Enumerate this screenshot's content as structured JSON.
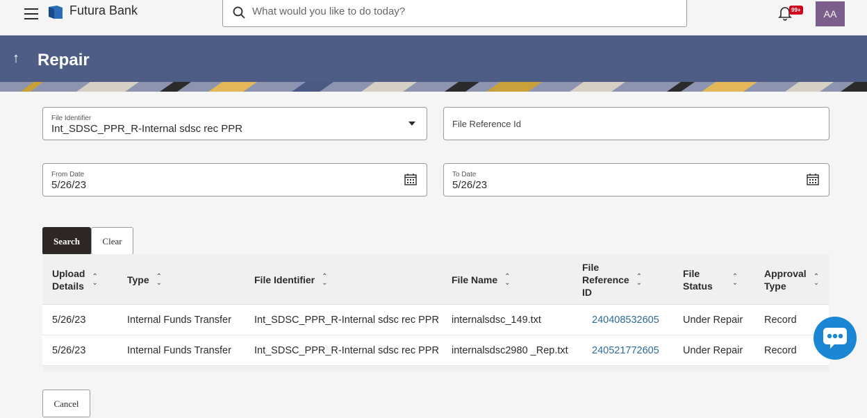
{
  "header": {
    "brand": "Futura Bank",
    "search_placeholder": "What would you like to do today?",
    "notification_count": "99+",
    "avatar_initials": "AA"
  },
  "banner": {
    "title": "Repair"
  },
  "form": {
    "file_identifier": {
      "label": "File Identifier",
      "value": "Int_SDSC_PPR_R-Internal sdsc rec PPR"
    },
    "file_reference": {
      "placeholder": "File Reference Id"
    },
    "from_date": {
      "label": "From Date",
      "value": "5/26/23"
    },
    "to_date": {
      "label": "To Date",
      "value": "5/26/23"
    },
    "search_label": "Search",
    "clear_label": "Clear"
  },
  "table": {
    "columns": [
      {
        "line1": "Upload",
        "line2": "Details",
        "line3": ""
      },
      {
        "line1": "Type",
        "line2": "",
        "line3": ""
      },
      {
        "line1": "File Identifier",
        "line2": "",
        "line3": ""
      },
      {
        "line1": "File Name",
        "line2": "",
        "line3": ""
      },
      {
        "line1": "File",
        "line2": "Reference",
        "line3": "ID"
      },
      {
        "line1": "File",
        "line2": "Status",
        "line3": ""
      },
      {
        "line1": "Approval",
        "line2": "Type",
        "line3": ""
      }
    ],
    "rows": [
      {
        "upload": "5/26/23",
        "type": "Internal Funds Transfer",
        "identifier": "Int_SDSC_PPR_R-Internal sdsc rec PPR",
        "file_name": "internalsdsc_149.txt",
        "reference_id": "240408532605",
        "status": "Under Repair",
        "approval": "Record"
      },
      {
        "upload": "5/26/23",
        "type": "Internal Funds Transfer",
        "identifier": "Int_SDSC_PPR_R-Internal sdsc rec PPR",
        "file_name": "internalsdsc2980 _Rep.txt",
        "reference_id": "240521772605",
        "status": "Under Repair",
        "approval": "Record"
      }
    ]
  },
  "footer": {
    "cancel_label": "Cancel"
  }
}
